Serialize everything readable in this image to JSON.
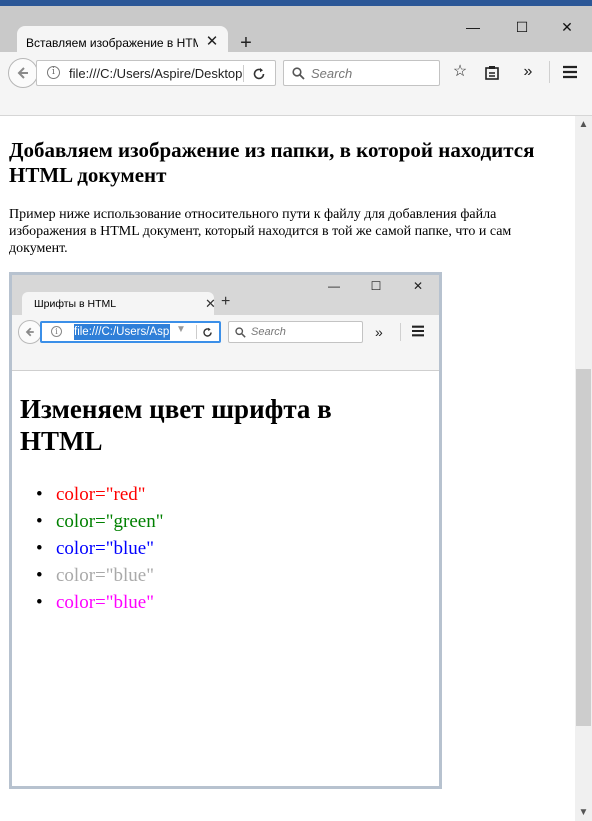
{
  "browser": {
    "tab_title": "Вставляем изображение в HTML",
    "tab_close": "✕",
    "new_tab": "+",
    "minimize": "—",
    "maximize": "☐",
    "close": "✕",
    "url": "file:///C:/Users/Aspire/Desktop",
    "search_placeholder": "Search",
    "icons": {
      "back": "back-arrow-icon",
      "info": "info-icon",
      "reload": "reload-icon",
      "search": "search-icon",
      "bookmark": "star-icon",
      "reader": "clipboard-icon",
      "overflow": "double-chevron-icon",
      "menu": "hamburger-menu-icon"
    }
  },
  "page": {
    "title": "Добавляем изображение из папки, в которой находится HTML документ",
    "paragraph": "Пример ниже использование относительного пути к файлу для добавления файла изборажения в HTML документ, который находится в той же самой папке, что и сам документ."
  },
  "embedded": {
    "tab_title": "Шрифты в HTML",
    "url": "file:///C:/Users/Aspire",
    "search_placeholder": "Search",
    "heading": "Изменяем цвет шрифта в HTML",
    "list": [
      {
        "text": "color=\"red\"",
        "color": "#ff0000"
      },
      {
        "text": "color=\"green\"",
        "color": "#008000"
      },
      {
        "text": "color=\"blue\"",
        "color": "#0000ff"
      },
      {
        "text": "color=\"blue\"",
        "color": "#a9a9a9"
      },
      {
        "text": "color=\"blue\"",
        "color": "#ff00ff"
      }
    ]
  }
}
